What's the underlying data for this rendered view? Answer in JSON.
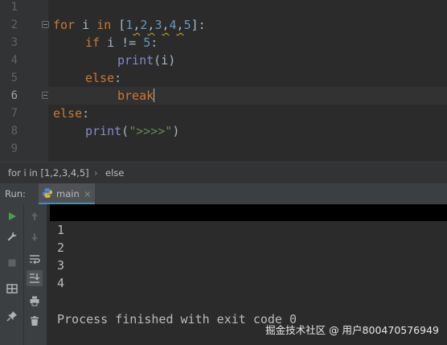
{
  "editor": {
    "line_numbers": [
      "1",
      "2",
      "3",
      "4",
      "5",
      "6",
      "7",
      "8",
      "9"
    ],
    "code": {
      "l2": {
        "for": "for",
        "i": " i ",
        "in": "in",
        "open": " [",
        "n1": "1",
        "c1": ",",
        "n2": "2",
        "c2": ",",
        "n3": "3",
        "c3": ",",
        "n4": "4",
        "c4": ",",
        "n5": "5",
        "close": "]:"
      },
      "l3": {
        "if": "if",
        "rest": " i != ",
        "num": "5",
        "colon": ":"
      },
      "l4": {
        "print": "print",
        "args": "(i)"
      },
      "l5": {
        "else": "else",
        "colon": ":"
      },
      "l6": {
        "break": "break"
      },
      "l7": {
        "else": "else",
        "colon": ":"
      },
      "l8": {
        "print": "print",
        "open": "(",
        "str": "\">>>>\"",
        "close": ")"
      }
    }
  },
  "breadcrumb": {
    "item1": "for i in [1,2,3,4,5]",
    "sep": "›",
    "item2": "else"
  },
  "run_panel": {
    "label": "Run:",
    "tab": "main",
    "close": "×"
  },
  "console": {
    "output": [
      "1",
      "2",
      "3",
      "4"
    ],
    "exit_message": "Process finished with exit code 0"
  },
  "watermark": "掘金技术社区 @ 用户800470576949",
  "icons": [
    "play-icon",
    "wrench-icon",
    "stop-icon",
    "layout-icon",
    "pin-icon",
    "up-arrow-icon",
    "down-arrow-icon",
    "soft-wrap-icon",
    "scroll-to-end-icon",
    "print-icon",
    "trash-icon",
    "python-icon"
  ],
  "colors": {
    "keyword": "#cc7832",
    "number": "#6897bb",
    "builtin": "#8888c6",
    "string": "#6a8759",
    "text": "#a9b7c6",
    "run_green": "#499c54"
  }
}
